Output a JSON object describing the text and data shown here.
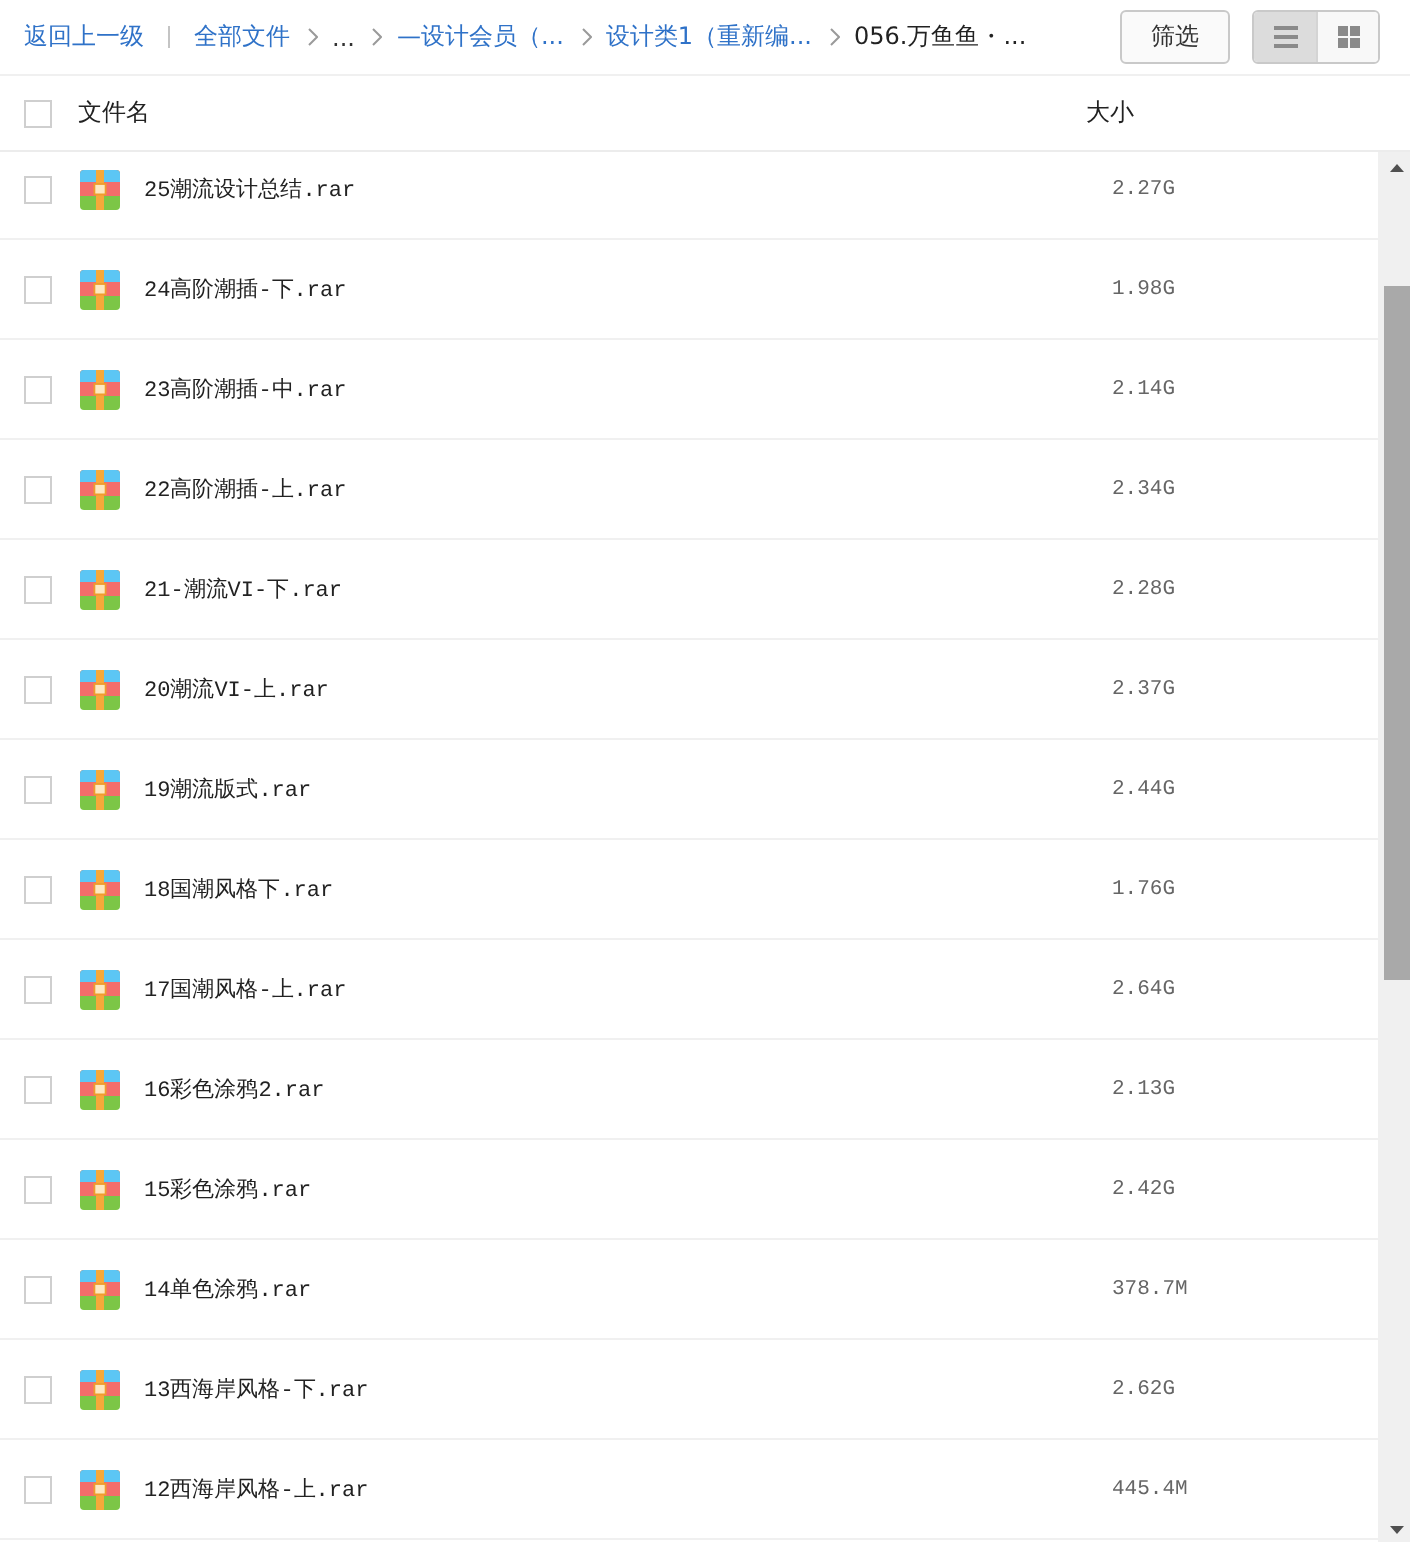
{
  "toolbar": {
    "back_link": "返回上一级",
    "breadcrumbs": [
      {
        "label": "全部文件",
        "kind": "link"
      },
      {
        "label": "...",
        "kind": "ellipsis"
      },
      {
        "label": "—设计会员（...",
        "kind": "link"
      },
      {
        "label": "设计类1（重新编...",
        "kind": "link"
      },
      {
        "label": "056.万鱼鱼・...",
        "kind": "current"
      }
    ],
    "filter_button": "筛选",
    "view_modes": [
      {
        "kind": "list",
        "selected": true
      },
      {
        "kind": "grid",
        "selected": false
      }
    ]
  },
  "table": {
    "select_all": {
      "checked": false
    },
    "columns": [
      "文件名",
      "大小"
    ],
    "rows": [
      {
        "name": "25潮流设计总结.rar",
        "size": "2.27G",
        "checked": false
      },
      {
        "name": "24高阶潮插-下.rar",
        "size": "1.98G",
        "checked": false
      },
      {
        "name": "23高阶潮插-中.rar",
        "size": "2.14G",
        "checked": false
      },
      {
        "name": "22高阶潮插-上.rar",
        "size": "2.34G",
        "checked": false
      },
      {
        "name": "21-潮流VI-下.rar",
        "size": "2.28G",
        "checked": false
      },
      {
        "name": "20潮流VI-上.rar",
        "size": "2.37G",
        "checked": false
      },
      {
        "name": "19潮流版式.rar",
        "size": "2.44G",
        "checked": false
      },
      {
        "name": "18国潮风格下.rar",
        "size": "1.76G",
        "checked": false
      },
      {
        "name": "17国潮风格-上.rar",
        "size": "2.64G",
        "checked": false
      },
      {
        "name": "16彩色涂鸦2.rar",
        "size": "2.13G",
        "checked": false
      },
      {
        "name": "15彩色涂鸦.rar",
        "size": "2.42G",
        "checked": false
      },
      {
        "name": "14单色涂鸦.rar",
        "size": "378.7M",
        "checked": false
      },
      {
        "name": "13西海岸风格-下.rar",
        "size": "2.62G",
        "checked": false
      },
      {
        "name": "12西海岸风格-上.rar",
        "size": "445.4M",
        "checked": false
      }
    ]
  }
}
